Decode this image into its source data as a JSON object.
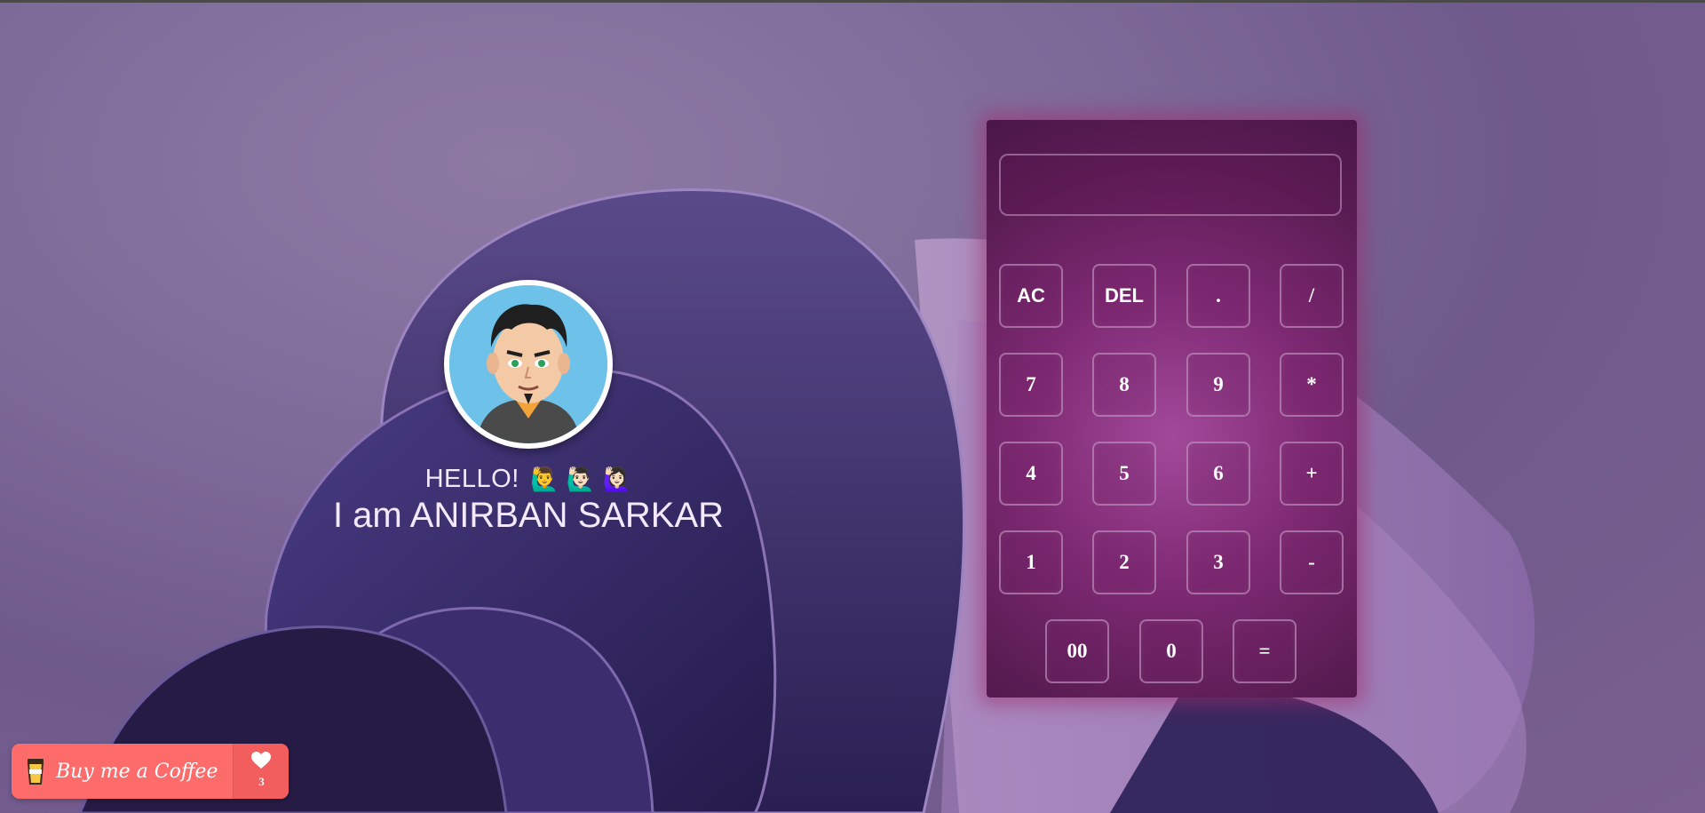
{
  "profile": {
    "greeting": "HELLO!",
    "greeting_emojis": "🙋‍♂️ 🙋🏻‍♂️ 🙋🏻‍♀️",
    "name": "I am ANIRBAN SARKAR",
    "avatar_icon": "cartoon-avatar"
  },
  "calculator": {
    "display_value": "",
    "keys": {
      "ac": "AC",
      "del": "DEL",
      "dot": ".",
      "divide": "/",
      "seven": "7",
      "eight": "8",
      "nine": "9",
      "multiply": "*",
      "four": "4",
      "five": "5",
      "six": "6",
      "plus": "+",
      "one": "1",
      "two": "2",
      "three": "3",
      "minus": "-",
      "double_zero": "00",
      "zero": "0",
      "equals": "="
    },
    "accent_color": "#7f2a74"
  },
  "coffee_widget": {
    "label": "Buy me a Coffee",
    "count": "3",
    "icons": [
      "coffee-cup-icon",
      "heart-icon"
    ],
    "color": "#fe6b6b"
  }
}
